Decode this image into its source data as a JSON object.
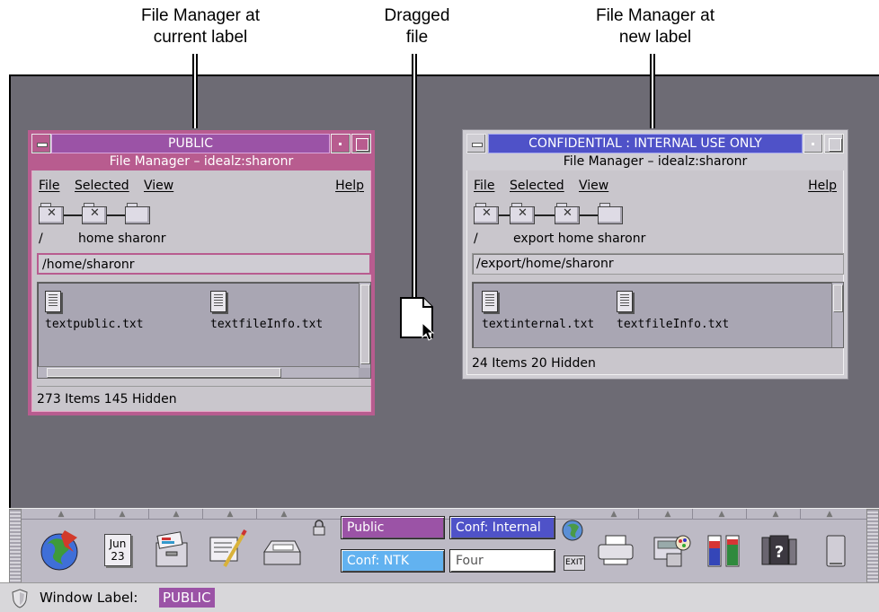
{
  "callouts": {
    "left": [
      "File Manager at",
      "current label"
    ],
    "middle": [
      "Dragged",
      "file"
    ],
    "right": [
      "File Manager at",
      "new label"
    ]
  },
  "window_public": {
    "label": "PUBLIC",
    "title": "File Manager – idealz:sharonr",
    "menu": {
      "file": "File",
      "selected": "Selected",
      "view": "View",
      "help": "Help"
    },
    "path_segments": [
      "/",
      "home sharonr"
    ],
    "path_field": "/home/sharonr",
    "files": [
      "textpublic.txt",
      "textfileInfo.txt"
    ],
    "status": "273 Items 145 Hidden",
    "colors": {
      "frame": "#b85c8f",
      "label": "#9b53a6"
    }
  },
  "window_confidential": {
    "label": "CONFIDENTIAL : INTERNAL USE ONLY",
    "title": "File Manager – idealz:sharonr",
    "menu": {
      "file": "File",
      "selected": "Selected",
      "view": "View",
      "help": "Help"
    },
    "path_segments": [
      "/",
      "export home sharonr"
    ],
    "path_field": "/export/home/sharonr",
    "files": [
      "textinternal.txt",
      "textfileInfo.txt"
    ],
    "status": "24 Items 20 Hidden",
    "colors": {
      "frame": "#cfcdd3",
      "label": "#4f52c8"
    }
  },
  "front_panel": {
    "calendar": {
      "month": "Jun",
      "day": "23"
    },
    "workspaces": {
      "public": "Public",
      "internal": "Conf: Internal",
      "ntk": "Conf: NTK",
      "four": "Four"
    },
    "exit": "EXIT",
    "icons": [
      "globe-icon",
      "calendar-icon",
      "file-cabinet-icon",
      "text-editor-icon",
      "mailbox-icon",
      "lock-icon",
      "earth-icon",
      "printer-icon",
      "style-manager-icon",
      "performance-meter-icon",
      "help-books-icon",
      "trash-icon"
    ]
  },
  "window_label_bar": {
    "label": "Window Label:",
    "value": "PUBLIC"
  }
}
